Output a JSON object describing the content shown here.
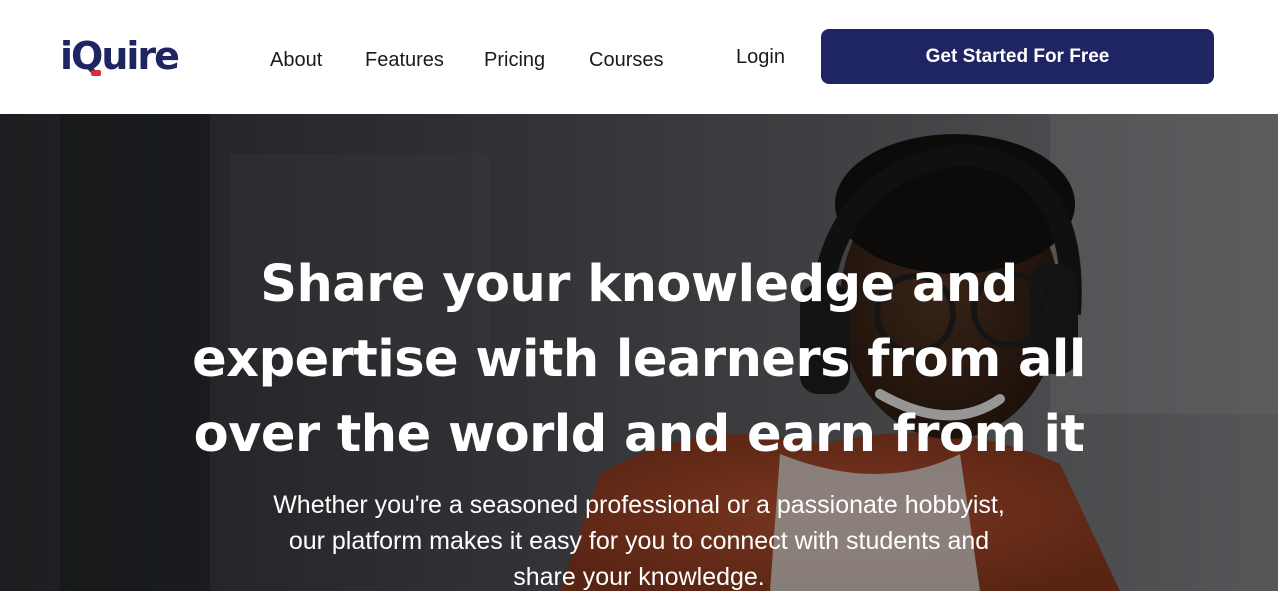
{
  "header": {
    "logo": {
      "part1": "i",
      "part2": "Q",
      "part3": "uire",
      "colors": {
        "text": "#1f2463",
        "accent": "#d32f3c"
      }
    },
    "nav": [
      {
        "label": "About"
      },
      {
        "label": "Features"
      },
      {
        "label": "Pricing"
      },
      {
        "label": "Courses"
      }
    ],
    "login_label": "Login",
    "cta_label": "Get Started For Free",
    "cta_color": "#1f2463"
  },
  "hero": {
    "title": "Share your knowledge and expertise with learners from all over the world and earn from it",
    "subtitle": "Whether you're a seasoned professional or a passionate hobbyist, our platform makes it easy for you to connect with students and share your knowledge."
  }
}
